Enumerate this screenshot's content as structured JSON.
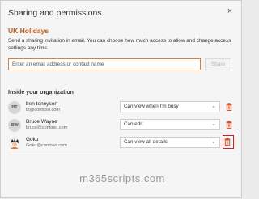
{
  "dialog": {
    "title": "Sharing and permissions",
    "close_glyph": "×"
  },
  "share": {
    "section_title": "UK Holidays",
    "description": "Send a sharing invitation in email. You can choose how much access to allow and change access settings any time.",
    "input_placeholder": "Enter an email address or contact name",
    "input_value": "",
    "share_label": "Share"
  },
  "org": {
    "title": "Inside your organization",
    "people": [
      {
        "initials": "BT",
        "name": "ben tennyson",
        "email": "bt@contoso.com",
        "permission": "Can view when I'm busy"
      },
      {
        "initials": "BW",
        "name": "Bruce Wayne",
        "email": "bruce@contoso.com",
        "permission": "Can edit"
      },
      {
        "initials": "",
        "name": "Goku",
        "email": "Goku@contoso.com",
        "permission": "Can view all details",
        "highlighted_delete": true
      }
    ]
  },
  "icons": {
    "close": "close-icon",
    "chevron": "chevron-down-icon",
    "delete": "trash-icon",
    "avatar_photo": "avatar-photo-icon"
  },
  "colors": {
    "accent": "#c0561a",
    "input_border": "#d4803e",
    "delete_icon": "#d04a1e",
    "highlight_box": "#d21f1f"
  },
  "watermark": "m365scripts.com"
}
